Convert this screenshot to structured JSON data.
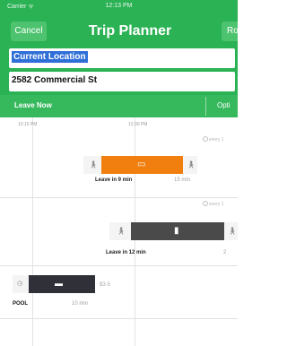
{
  "status_bar": {
    "carrier": "Carrier ᯤ",
    "time": "12:13 PM"
  },
  "nav": {
    "cancel_label": "Cancel",
    "title": "Trip Planner",
    "route_label": "Ro"
  },
  "inputs": {
    "from": {
      "value": "Current Location"
    },
    "to": {
      "value": "2582 Commercial St"
    }
  },
  "options_bar": {
    "leave_label": "Leave Now",
    "options_label": "Opti"
  },
  "timeline": {
    "time_labels": [
      "12:15 PM",
      "12:30 PM"
    ],
    "routes": [
      {
        "frequency": "every 1",
        "leave": "Leave in 9 min",
        "duration": "15 min",
        "color": "#f07f10"
      },
      {
        "frequency": "every 1",
        "leave": "Leave in 12 min",
        "duration": "2",
        "color": "#4a4a4a"
      },
      {
        "service": "POOL",
        "price": "$3-5",
        "duration": "10 min",
        "color": "#2f3038"
      }
    ]
  },
  "colors": {
    "header_green": "#2bb254",
    "accent_orange": "#f07f10",
    "dark_bar": "#4a4a4a"
  }
}
